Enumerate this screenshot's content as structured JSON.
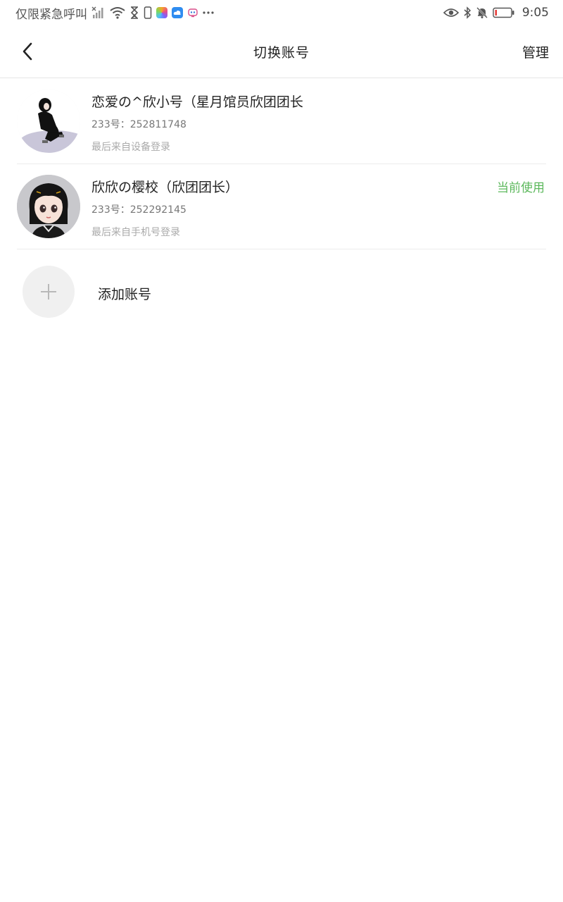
{
  "status_bar": {
    "carrier_text": "仅限紧急呼叫",
    "time": "9:05",
    "left_icons": [
      "no-signal-icon",
      "wifi-icon",
      "hourglass-icon",
      "phone-icon",
      "app-photos-icon",
      "app-cloud-icon",
      "app-bot-icon",
      "more-dots-icon"
    ],
    "right_icons": [
      "eye-icon",
      "bluetooth-icon",
      "mute-bell-icon",
      "battery-low-icon"
    ],
    "battery_level": 0.1
  },
  "nav": {
    "back_icon": "chevron-left-icon",
    "title": "切换账号",
    "action_label": "管理"
  },
  "accounts": [
    {
      "name": "恋爱の^欣小号（星月馆员欣团团长",
      "id_text": "233号：252811748",
      "login_text": "最后来自设备登录",
      "current_label": ""
    },
    {
      "name": "欣欣の樱校（欣团团长）",
      "id_text": "233号：252292145",
      "login_text": "最后来自手机号登录",
      "current_label": "当前使用"
    }
  ],
  "add_account": {
    "icon": "plus-icon",
    "label": "添加账号"
  },
  "colors": {
    "current_green": "#5cb85c",
    "divider": "#ececec",
    "add_circle_bg": "#f0f0f0"
  }
}
